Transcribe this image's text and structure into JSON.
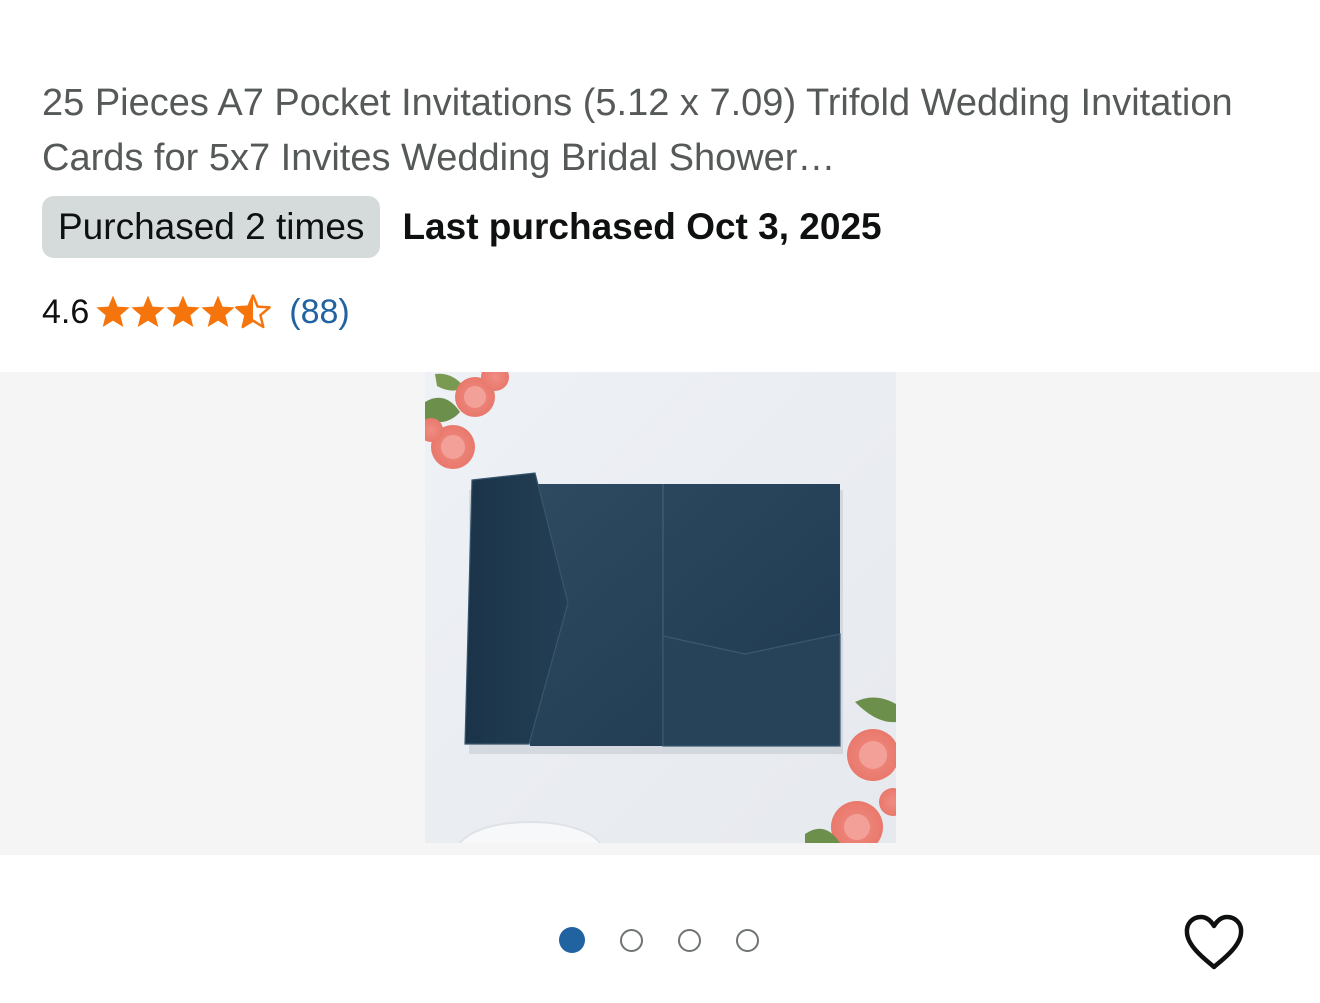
{
  "product": {
    "title": "25 Pieces A7 Pocket Invitations (5.12 x 7.09) Trifold Wedding Invitation Cards for 5x7 Invites Wedding Bridal Shower…",
    "purchase_badge": "Purchased 2 times",
    "last_purchased": "Last purchased Oct 3, 2025"
  },
  "rating": {
    "value": "4.6",
    "stars": 4.5,
    "count": "(88)",
    "star_color": "#f5750c"
  },
  "gallery": {
    "image_icon": "navy-pocket-invitation-with-roses",
    "image_count": 4,
    "active_index": 0
  },
  "actions": {
    "favorite_icon": "heart-outline-icon"
  },
  "colors": {
    "badge_bg": "#d5dbdb",
    "link": "#2162a1",
    "title": "#565959",
    "gallery_bg": "#f5f5f5"
  }
}
